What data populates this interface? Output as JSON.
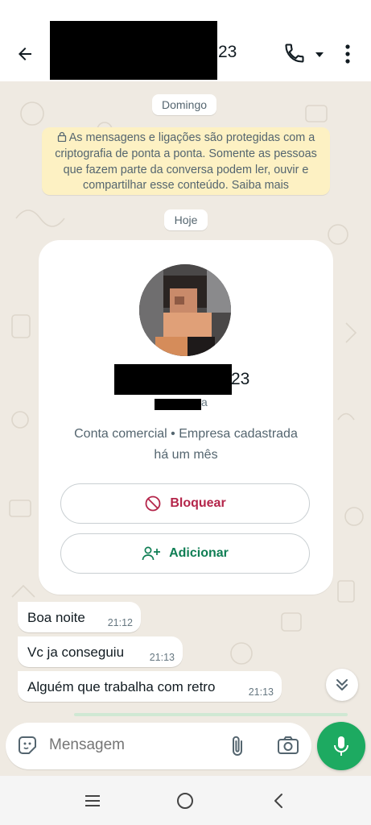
{
  "header": {
    "name_suffix": "23",
    "icons": [
      "back-arrow-icon",
      "phone-icon",
      "caret-down-icon",
      "more-vert-icon"
    ]
  },
  "chat": {
    "date_sunday": "Domingo",
    "encryption_notice": "As mensagens e ligações são protegidas com a criptografia de ponta a ponta. Somente as pessoas que fazem parte da conversa podem ler, ouvir e compartilhar esse conteúdo. Saiba mais",
    "date_today": "Hoje"
  },
  "contact_card": {
    "name_suffix": "23",
    "subtitle_suffix": "a",
    "business_line1": "Conta comercial • Empresa cadastrada",
    "business_line2": "há um mês",
    "block_label": "Bloquear",
    "add_label": "Adicionar"
  },
  "messages": [
    {
      "text": "Boa noite",
      "time": "21:12"
    },
    {
      "text": "Vc ja conseguiu",
      "time": "21:13"
    },
    {
      "text": "Alguém que trabalha com retro",
      "time": "21:13"
    }
  ],
  "composer": {
    "placeholder": "Mensagem"
  },
  "colors": {
    "accent_green": "#1daa61",
    "block_red": "#b4254a",
    "add_green": "#0f7e54",
    "notice_bg": "#fdf1c3",
    "chat_bg": "#efeae2"
  }
}
